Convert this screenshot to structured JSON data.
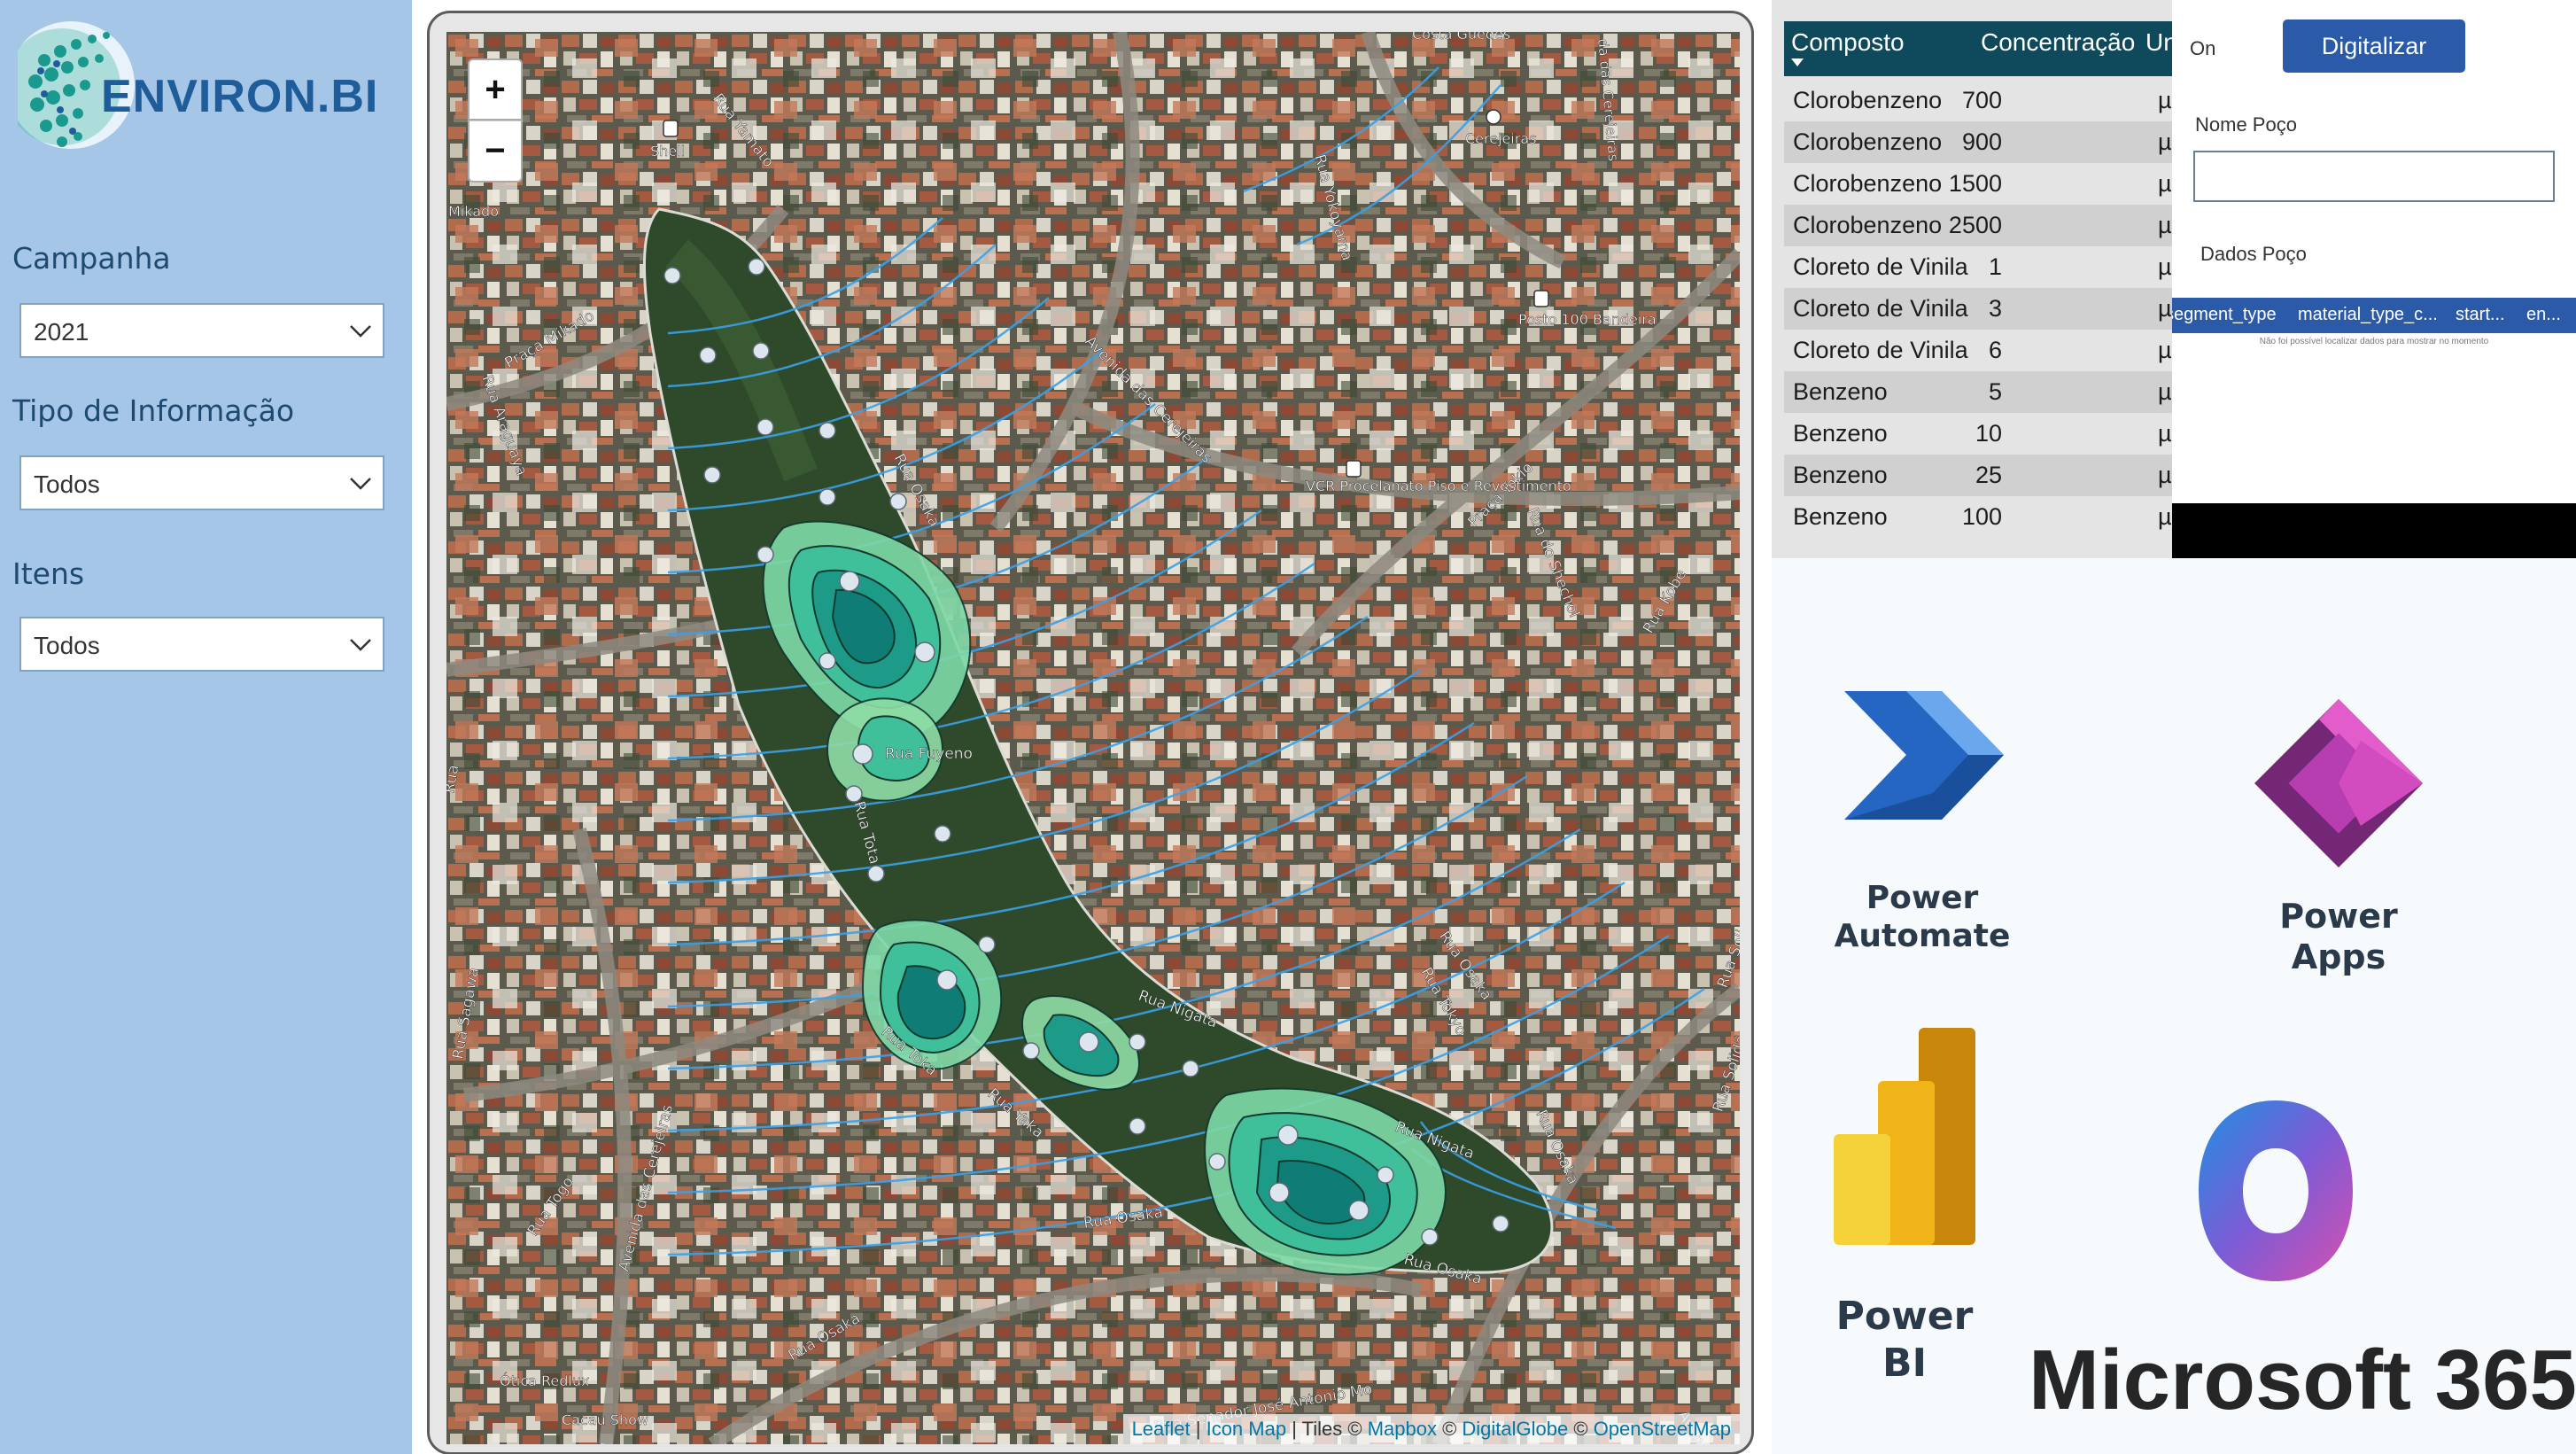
{
  "sidebar": {
    "logo_text": "ENVIRON.BI",
    "filters": [
      {
        "label": "Campanha",
        "value": "2021"
      },
      {
        "label": "Tipo de Informação",
        "value": "Todos"
      },
      {
        "label": "Itens",
        "value": "Todos"
      }
    ]
  },
  "map": {
    "zoom_in_label": "+",
    "zoom_out_label": "−",
    "attribution": {
      "leaflet": "Leaflet",
      "sep1": " | ",
      "icon_map": "Icon Map",
      "sep2": " | Tiles © ",
      "mapbox": "Mapbox",
      "sep3": " © ",
      "digitalglobe": "DigitalGlobe",
      "sep4": " © ",
      "osm": "OpenStreetMap"
    },
    "street_labels": [
      "Rua Yamato",
      "Rua Yokoyama",
      "Praça Mikado",
      "Rua Araguaya",
      "Rua Osaka",
      "Avenida das Cerejeiras",
      "Praça Tokio",
      "Rua do Shechol",
      "Rua Kobe",
      "Rua Nigata",
      "Rua Toka",
      "Rua Yaka",
      "Rua Osaka",
      "Rua Osaka",
      "Rua Tokyo",
      "Rua Togo",
      "Avenida das Cerejeiras",
      "Rua Osaka",
      "Rua Osaka",
      "Rua Nigata",
      "Rua Osaka",
      "Rua Sagawa",
      "Rua Solidão",
      "Rua Senador José Antonio Mo",
      "Rua Tota",
      "Rua Fuyeno",
      "Rua",
      "Rua Solid",
      "Aven"
    ],
    "poi_labels": [
      "Shell",
      "Mikado",
      "Cerejeiras",
      "Posto 100 Bandeira",
      "VCR Procelanato Piso e Revestimento",
      "Ótica Redlux",
      "Cacau Show",
      "Costa Guedes",
      "da das Cerejeiras"
    ]
  },
  "table": {
    "columns": [
      "Composto",
      "Concentração",
      "Un"
    ],
    "rows": [
      {
        "composto": "Clorobenzeno",
        "concentracao": "700",
        "un": "µg"
      },
      {
        "composto": "Clorobenzeno",
        "concentracao": "900",
        "un": "µg"
      },
      {
        "composto": "Clorobenzeno",
        "concentracao": "1500",
        "un": "µg"
      },
      {
        "composto": "Clorobenzeno",
        "concentracao": "2500",
        "un": "µg"
      },
      {
        "composto": "Cloreto de Vinila",
        "concentracao": "1",
        "un": "µg"
      },
      {
        "composto": "Cloreto de Vinila",
        "concentracao": "3",
        "un": "µg"
      },
      {
        "composto": "Cloreto de Vinila",
        "concentracao": "6",
        "un": "µg"
      },
      {
        "composto": "Benzeno",
        "concentracao": "5",
        "un": "µg"
      },
      {
        "composto": "Benzeno",
        "concentracao": "10",
        "un": "µg"
      },
      {
        "composto": "Benzeno",
        "concentracao": "25",
        "un": "µg"
      },
      {
        "composto": "Benzeno",
        "concentracao": "100",
        "un": "µg"
      }
    ]
  },
  "app_form": {
    "toggle_label": "On",
    "digitalizar_label": "Digitalizar",
    "nome_poco_label": "Nome Poço",
    "nome_poco_value": "",
    "dados_poco_label": "Dados Poço",
    "grid_columns": [
      "segment_type",
      "material_type_c...",
      "start...",
      "en..."
    ],
    "grid_empty_text": "Não foi possível localizar dados para mostrar no momento"
  },
  "logos": {
    "power_automate": [
      "Power",
      "Automate"
    ],
    "power_apps": [
      "Power",
      "Apps"
    ],
    "power_bi": [
      "Power",
      "BI"
    ],
    "microsoft_365": "Microsoft 365"
  },
  "colors": {
    "sidebar_bg": "#a6c6e8",
    "table_header_bg": "#0e4a5c",
    "app_accent": "#2b5aa8",
    "contour_fill": "#3fbf9a",
    "flow_line": "#3aa0e8"
  }
}
